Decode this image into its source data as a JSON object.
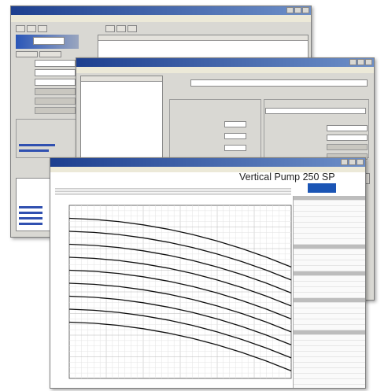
{
  "chart_window": {
    "sheet_title": "Vertical Pump 250 SP"
  },
  "chart_data": {
    "type": "line",
    "title": "Vertical Pump 250 SP",
    "xlabel": "",
    "ylabel": "",
    "x": [
      0,
      1,
      2,
      3,
      4,
      5,
      6,
      7,
      8,
      9
    ],
    "series": [
      {
        "values": [
          148,
          147,
          145,
          142,
          138,
          133,
          127,
          120,
          112,
          103
        ]
      },
      {
        "values": [
          136,
          135,
          133,
          130,
          126,
          121,
          115,
          108,
          100,
          91
        ]
      },
      {
        "values": [
          124,
          123,
          121,
          118,
          114,
          109,
          103,
          96,
          88,
          79
        ]
      },
      {
        "values": [
          112,
          111,
          109,
          106,
          102,
          97,
          91,
          84,
          76,
          67
        ]
      },
      {
        "values": [
          100,
          99,
          97,
          94,
          90,
          85,
          79,
          72,
          64,
          55
        ]
      },
      {
        "values": [
          88,
          87,
          85,
          82,
          78,
          73,
          67,
          60,
          52,
          43
        ]
      },
      {
        "values": [
          76,
          75,
          73,
          70,
          66,
          61,
          55,
          48,
          40,
          31
        ]
      },
      {
        "values": [
          64,
          63,
          61,
          58,
          54,
          49,
          43,
          36,
          28,
          19
        ]
      },
      {
        "values": [
          52,
          51,
          49,
          46,
          42,
          37,
          31,
          24,
          16,
          7
        ]
      }
    ],
    "xlim": [
      0,
      9
    ],
    "ylim": [
      0,
      160
    ],
    "grid": true
  }
}
